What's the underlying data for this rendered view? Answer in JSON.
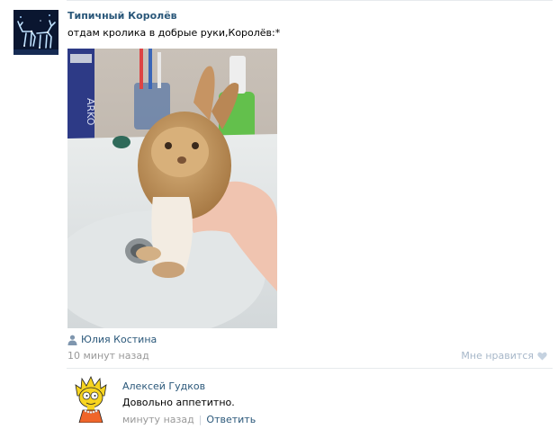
{
  "post": {
    "author": "Типичный Королёв",
    "text": "отдам кролика в добрые руки,Королёв:*",
    "signer": "Юлия Костина",
    "time": "10 минут назад",
    "like_label": "Мне нравится"
  },
  "reply": {
    "author": "Алексей Гудков",
    "text": "Довольно аппетитно.",
    "time": "минуту назад",
    "separator": "|",
    "action_label": "Ответить"
  },
  "colors": {
    "link": "#2b587a",
    "muted": "#999999",
    "like": "#a7b7c9",
    "divider": "#e7eaed"
  },
  "icons": {
    "signer": "person-icon",
    "like": "heart-icon"
  }
}
